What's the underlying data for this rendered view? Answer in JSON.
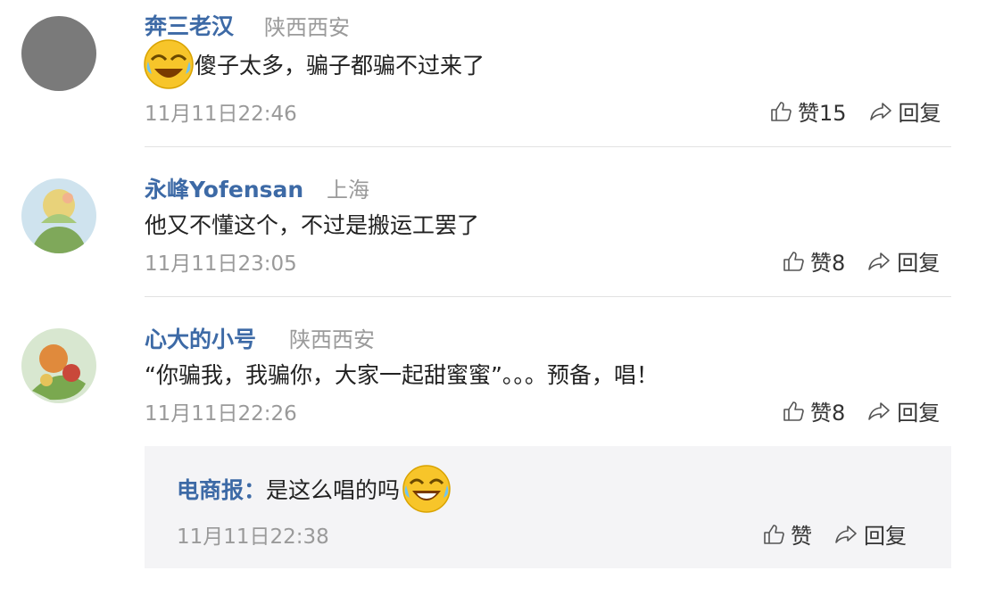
{
  "comments": [
    {
      "user": "奔三老汉",
      "location": "陕西西安",
      "text": "傻子太多，骗子都骗不过来了",
      "emoji": "crying-laughing-emoji",
      "time": "11月11日22:46",
      "like_label": "赞15",
      "reply_label": "回复"
    },
    {
      "user": "永峰Yofensan",
      "location": "上海",
      "text": "他又不懂这个，不过是搬运工罢了",
      "time": "11月11日23:05",
      "like_label": "赞8",
      "reply_label": "回复"
    },
    {
      "user": "心大的小号",
      "location": "陕西西安",
      "text": "“你骗我，我骗你，大家一起甜蜜蜜”。。。预备，唱！",
      "time": "11月11日22:26",
      "like_label": "赞8",
      "reply_label": "回复"
    }
  ],
  "reply": {
    "author": "电商报：",
    "text": "是这么唱的吗",
    "emoji": "laughing-emoji",
    "time": "11月11日22:38",
    "like_label": "赞",
    "reply_label": "回复"
  },
  "icons": {
    "like": "thumbs-up-icon",
    "reply": "share-arrow-icon"
  },
  "colors": {
    "username": "#3d6aa6",
    "meta": "#9a9a9a",
    "text": "#222222",
    "reply_background": "#f4f4f6",
    "divider": "#e2e2e2"
  }
}
